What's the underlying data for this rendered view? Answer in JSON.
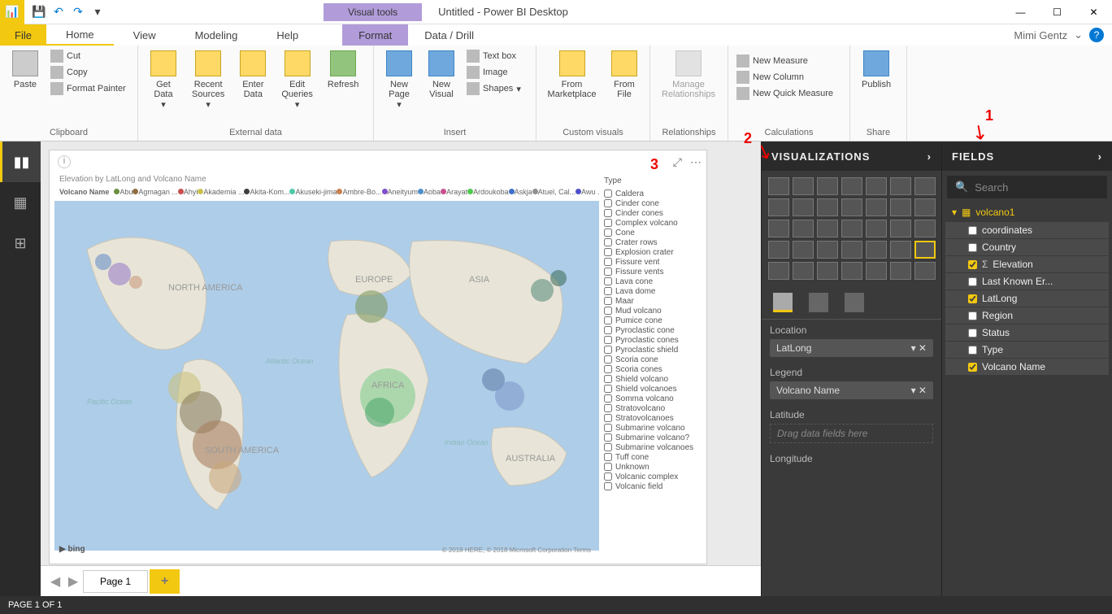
{
  "titlebar": {
    "title": "Untitled - Power BI Desktop",
    "visual_tools": "Visual tools"
  },
  "qat": {
    "save": "💾",
    "undo": "↶",
    "redo": "↷"
  },
  "win": {
    "min": "—",
    "max": "☐",
    "close": "✕"
  },
  "menu": {
    "file": "File",
    "home": "Home",
    "view": "View",
    "modeling": "Modeling",
    "help": "Help",
    "format": "Format",
    "datadrill": "Data / Drill"
  },
  "user": {
    "name": "Mimi Gentz",
    "caret": "⌄",
    "help": "?"
  },
  "ribbon": {
    "clipboard": {
      "label": "Clipboard",
      "paste": "Paste",
      "cut": "Cut",
      "copy": "Copy",
      "fp": "Format Painter"
    },
    "external": {
      "label": "External data",
      "getdata": "Get\nData",
      "recent": "Recent\nSources",
      "enter": "Enter\nData",
      "edit": "Edit\nQueries",
      "refresh": "Refresh"
    },
    "insert": {
      "label": "Insert",
      "newpage": "New\nPage",
      "newvisual": "New\nVisual",
      "textbox": "Text box",
      "image": "Image",
      "shapes": "Shapes"
    },
    "custom": {
      "label": "Custom visuals",
      "market": "From\nMarketplace",
      "file": "From\nFile"
    },
    "rel": {
      "label": "Relationships",
      "manage": "Manage\nRelationships"
    },
    "calc": {
      "label": "Calculations",
      "nm": "New Measure",
      "nc": "New Column",
      "nqm": "New Quick Measure"
    },
    "share": {
      "label": "Share",
      "publish": "Publish"
    }
  },
  "chart": {
    "title": "Elevation by LatLong and Volcano Name",
    "legend_label": "Volcano Name",
    "legend_items": [
      "Abu",
      "Agmagan ...",
      "Ahyi",
      "Akademia ...",
      "Akita-Kom...",
      "Akuseki-jima",
      "Ambre-Bo...",
      "Aneityum",
      "Aoba",
      "Arayat",
      "Ardoukoba",
      "Askja",
      "Atuel, Cal...",
      "Awu ..."
    ],
    "filter_title": "Type",
    "filter_items": [
      "Caldera",
      "Cinder cone",
      "Cinder cones",
      "Complex volcano",
      "Cone",
      "Crater rows",
      "Explosion crater",
      "Fissure vent",
      "Fissure vents",
      "Lava cone",
      "Lava dome",
      "Maar",
      "Mud volcano",
      "Pumice cone",
      "Pyroclastic cone",
      "Pyroclastic cones",
      "Pyroclastic shield",
      "Scoria cone",
      "Scoria cones",
      "Shield volcano",
      "Shield volcanoes",
      "Somma volcano",
      "Stratovolcano",
      "Stratovolcanoes",
      "Submarine volcano",
      "Submarine volcano?",
      "Submarine volcanoes",
      "Tuff cone",
      "Unknown",
      "Volcanic complex",
      "Volcanic field"
    ],
    "bing": "bing",
    "credits": "© 2018 HERE, © 2018 Microsoft Corporation Terms",
    "map_labels": {
      "na": "NORTH\nAMERICA",
      "sa": "SOUTH\nAMERICA",
      "eu": "EUROPE",
      "af": "AFRICA",
      "as": "ASIA",
      "au": "AUSTRALIA",
      "pac": "Pacific\nOcean",
      "atl": "Atlantic\nOcean",
      "ind": "Indian\nOcean"
    }
  },
  "annotations": {
    "one": "1",
    "two": "2",
    "three": "3"
  },
  "viz_panel": {
    "title": "VISUALIZATIONS",
    "wells": {
      "location": {
        "label": "Location",
        "value": "LatLong"
      },
      "legend": {
        "label": "Legend",
        "value": "Volcano Name"
      },
      "lat": {
        "label": "Latitude",
        "placeholder": "Drag data fields here"
      },
      "lon": {
        "label": "Longitude"
      }
    }
  },
  "fields_panel": {
    "title": "FIELDS",
    "search": "Search",
    "table": "volcano1",
    "items": [
      {
        "name": "coordinates",
        "checked": false,
        "sigma": false
      },
      {
        "name": "Country",
        "checked": false,
        "sigma": false
      },
      {
        "name": "Elevation",
        "checked": true,
        "sigma": true
      },
      {
        "name": "Last Known Er...",
        "checked": false,
        "sigma": false
      },
      {
        "name": "LatLong",
        "checked": true,
        "sigma": false
      },
      {
        "name": "Region",
        "checked": false,
        "sigma": false
      },
      {
        "name": "Status",
        "checked": false,
        "sigma": false
      },
      {
        "name": "Type",
        "checked": false,
        "sigma": false
      },
      {
        "name": "Volcano Name",
        "checked": true,
        "sigma": false
      }
    ]
  },
  "pages": {
    "page1": "Page 1",
    "add": "+"
  },
  "status": "PAGE 1 OF 1"
}
